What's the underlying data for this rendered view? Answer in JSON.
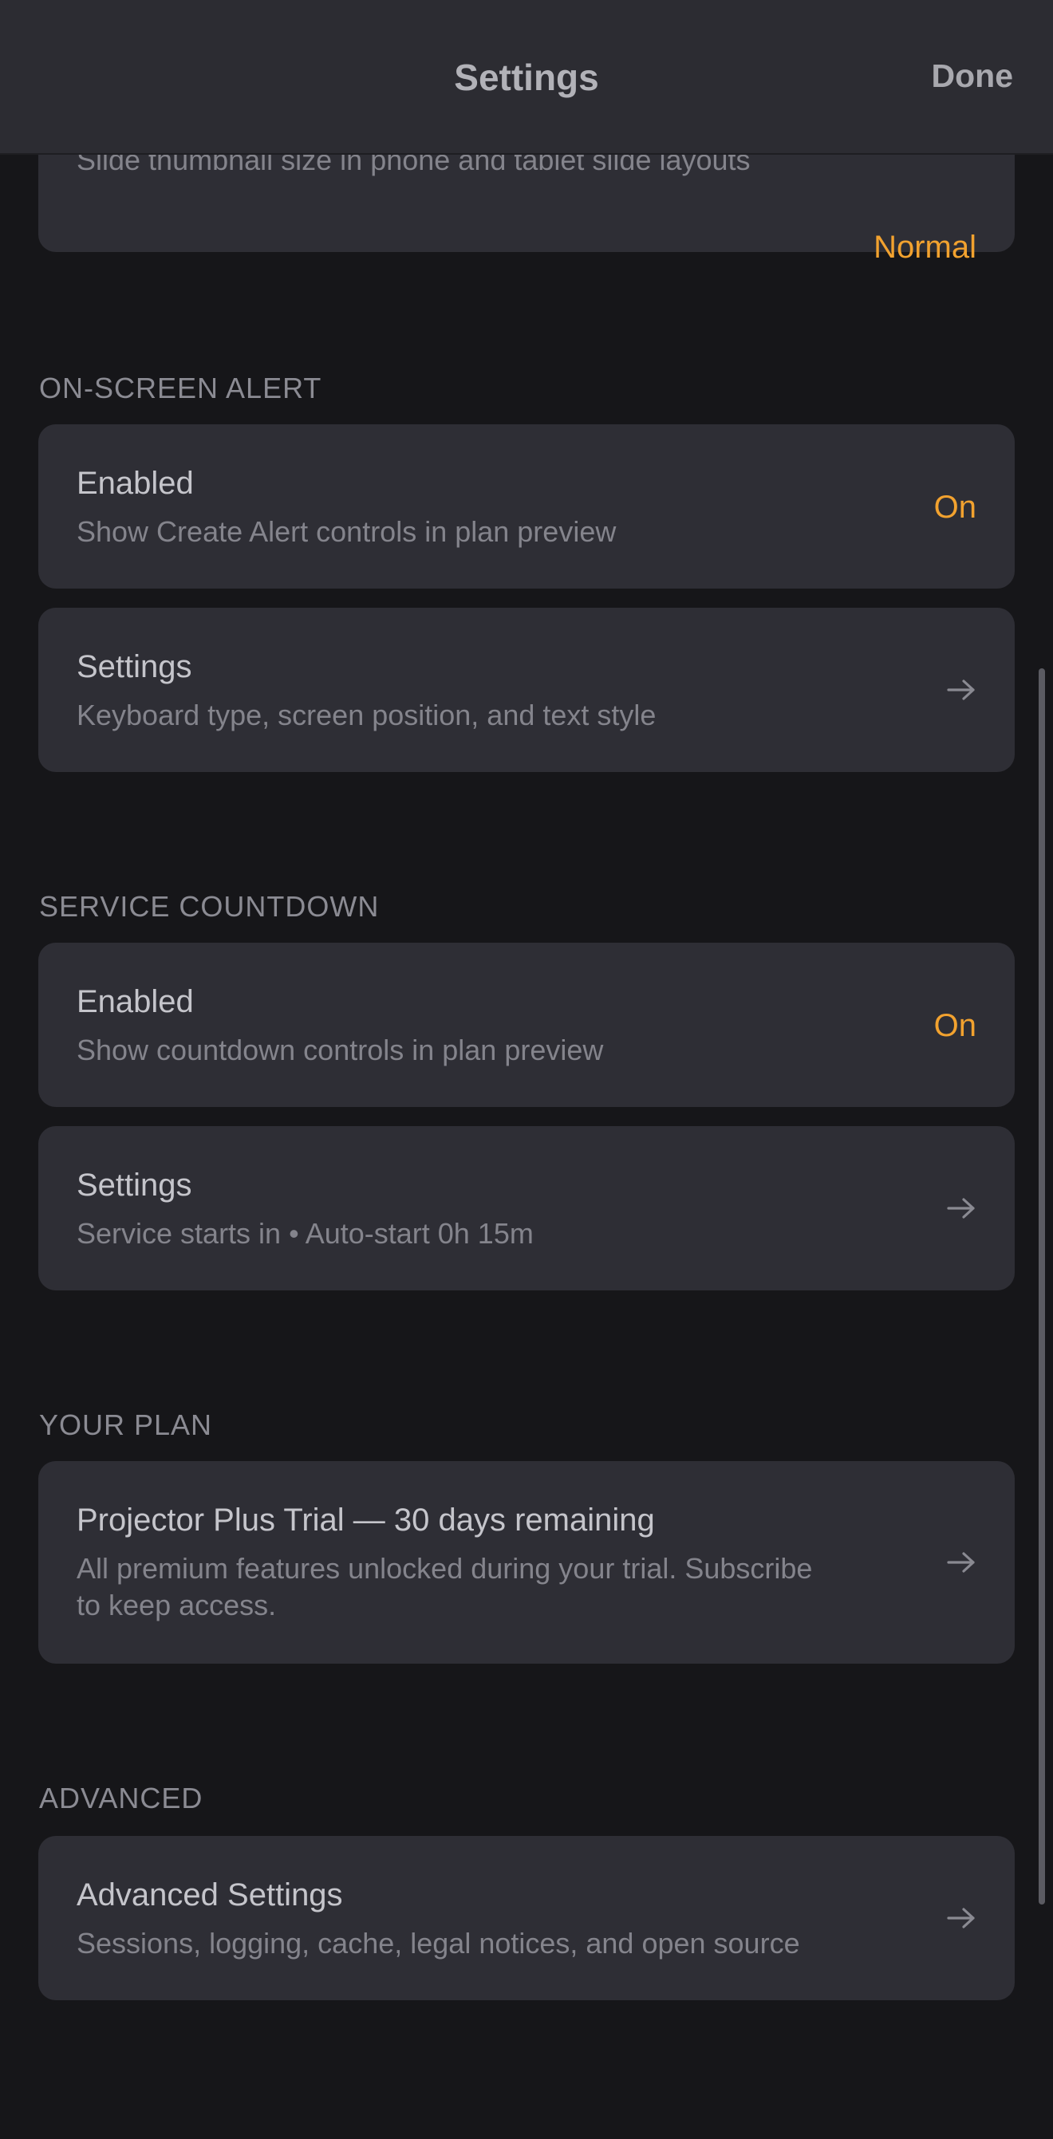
{
  "nav": {
    "title": "Settings",
    "done_label": "Done"
  },
  "display": {
    "thumbnail": {
      "subtitle": "Slide thumbnail size in phone and tablet slide layouts",
      "value": "Normal"
    }
  },
  "on_screen_alert": {
    "header": "ON-SCREEN ALERT",
    "enabled": {
      "title": "Enabled",
      "subtitle": "Show Create Alert controls in plan preview",
      "value": "On"
    },
    "settings": {
      "title": "Settings",
      "subtitle": "Keyboard type, screen position, and text style"
    }
  },
  "service_countdown": {
    "header": "SERVICE COUNTDOWN",
    "enabled": {
      "title": "Enabled",
      "subtitle": "Show countdown controls in plan preview",
      "value": "On"
    },
    "settings": {
      "title": "Settings",
      "subtitle": "Service starts in • Auto-start 0h 15m"
    }
  },
  "your_plan": {
    "header": "YOUR PLAN",
    "plan": {
      "title": "Projector Plus Trial — 30 days remaining",
      "subtitle": "All premium features unlocked during your trial. Subscribe to keep access."
    }
  },
  "advanced": {
    "header": "ADVANCED",
    "settings": {
      "title": "Advanced Settings",
      "subtitle": "Sessions, logging, cache, legal notices, and open source"
    }
  },
  "colors": {
    "background": "#161619",
    "card": "#2e2e35",
    "accent": "#f2a22f",
    "navbar": "#2c2c32"
  },
  "icons": {
    "row_chevron": "arrow-right-icon"
  }
}
